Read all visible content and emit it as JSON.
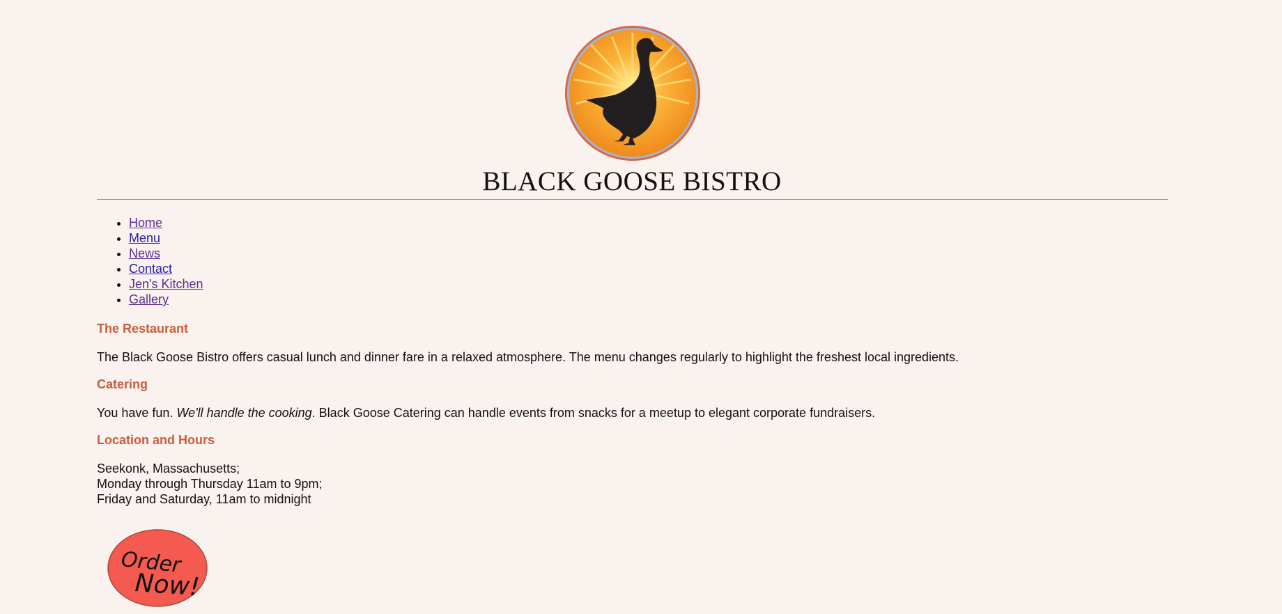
{
  "header": {
    "title": "BLACK GOOSE BISTRO",
    "logo_icon": "goose-sunburst-logo-icon"
  },
  "nav": {
    "items": [
      {
        "label": "Home",
        "visited": true
      },
      {
        "label": "Menu",
        "visited": false
      },
      {
        "label": "News",
        "visited": true
      },
      {
        "label": "Contact",
        "visited": false
      },
      {
        "label": "Jen's Kitchen",
        "visited": true
      },
      {
        "label": "Gallery",
        "visited": true
      }
    ]
  },
  "sections": {
    "restaurant": {
      "heading": "The Restaurant",
      "text": "The Black Goose Bistro offers casual lunch and dinner fare in a relaxed atmosphere. The menu changes regularly to highlight the freshest local ingredients."
    },
    "catering": {
      "heading": "Catering",
      "text_before": "You have fun. ",
      "text_em": "We'll handle the cooking",
      "text_after": ". Black Goose Catering can handle events from snacks for a meetup to elegant corporate fundraisers."
    },
    "location": {
      "heading": "Location and Hours",
      "lines": [
        "Seekonk, Massachusetts;",
        "Monday through Thursday 11am to 9pm;",
        "Friday and Saturday, 11am to midnight"
      ]
    }
  },
  "order_button": {
    "label_line1": "Order",
    "label_line2": "Now!"
  },
  "colors": {
    "background": "#faf2ee",
    "heading": "#c95d3c",
    "link": "#2a1ca6",
    "link_visited": "#5b2e8f",
    "rule": "#6f9fd6",
    "order_fill": "#f55a50"
  }
}
